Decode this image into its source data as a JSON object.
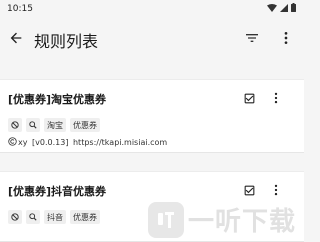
{
  "status_bar": {
    "time": "10:15"
  },
  "app_bar": {
    "title": "规则列表"
  },
  "rules": [
    {
      "title": "[优惠券]淘宝优惠券",
      "chips": [
        "淘宝",
        "优惠券"
      ],
      "author": "xy",
      "version": "[v0.0.13]",
      "url": "https://tkapi.misiai.com"
    },
    {
      "title": "[优惠券]抖音优惠券",
      "chips": [
        "抖音",
        "优惠券"
      ]
    }
  ],
  "icons": {
    "back": "arrow-back-icon",
    "filter": "filter-icon",
    "more": "more-vert-icon",
    "check": "checkbox-checked-icon",
    "disable": "block-icon",
    "search": "search-icon",
    "copyright": "copyright-icon"
  },
  "watermark": {
    "text": "一听下载"
  }
}
